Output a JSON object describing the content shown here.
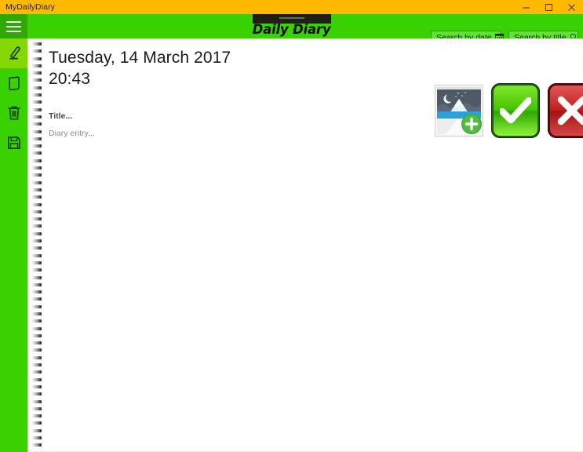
{
  "window": {
    "app_name": "MyDailyDiary",
    "controls": [
      {
        "name": "minimize",
        "glyph": "minimize-icon"
      },
      {
        "name": "maximize",
        "glyph": "maximize-icon"
      },
      {
        "name": "close",
        "glyph": "close-icon"
      }
    ],
    "titlebar_color": "#FFB900"
  },
  "appbar": {
    "title": "Daily Diary",
    "background_color": "#3ad100",
    "search_date": {
      "placeholder": "Search by date",
      "icon": "calendar-icon"
    },
    "search_title": {
      "placeholder": "Search by title",
      "icon": "search-icon"
    }
  },
  "sidebar": {
    "menu_button": "hamburger-menu-icon",
    "items": [
      {
        "label": "",
        "icon": "pen-write-icon",
        "name": "new-entry",
        "selected": true
      },
      {
        "label": "",
        "icon": "note-page-icon",
        "name": "entries"
      },
      {
        "label": "",
        "icon": "trash-delete-icon",
        "name": "delete"
      },
      {
        "label": "",
        "icon": "floppy-save-icon",
        "name": "save"
      }
    ]
  },
  "entry": {
    "date": "Tuesday, 14 March 2017",
    "time": "20:43",
    "title_placeholder": "Title...",
    "body_placeholder": "Diary entry..."
  },
  "actions": {
    "add_image": {
      "icon": "add-image-icon",
      "label": ""
    },
    "confirm": {
      "icon": "checkmark-icon",
      "label": "",
      "color": "#46c400"
    },
    "cancel": {
      "icon": "cross-icon",
      "label": "",
      "color": "#c41f1f"
    }
  }
}
